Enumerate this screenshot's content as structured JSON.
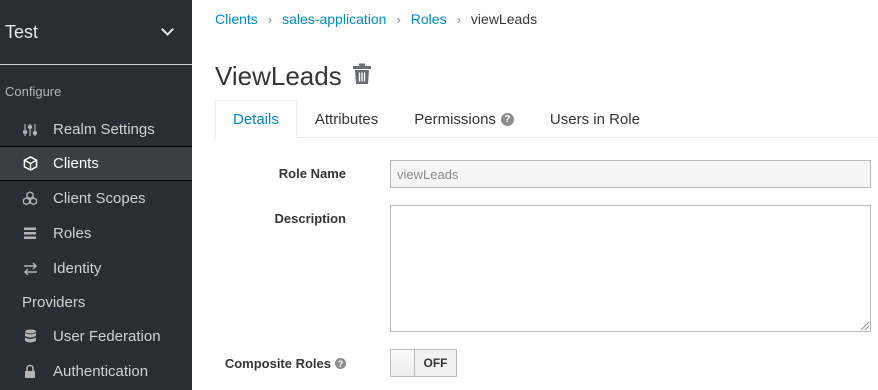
{
  "sidebar": {
    "realm": "Test",
    "section_title": "Configure",
    "items": [
      {
        "label": "Realm Settings",
        "icon": "sliders-icon"
      },
      {
        "label": "Clients",
        "icon": "cube-icon",
        "active": true
      },
      {
        "label": "Client Scopes",
        "icon": "cubes-icon"
      },
      {
        "label": "Roles",
        "icon": "list-icon"
      },
      {
        "label": "Identity",
        "icon": "exchange-icon"
      },
      {
        "label": "Providers",
        "icon": ""
      },
      {
        "label": "User Federation",
        "icon": "database-icon"
      },
      {
        "label": "Authentication",
        "icon": "lock-icon"
      }
    ]
  },
  "breadcrumb": {
    "items": [
      "Clients",
      "sales-application",
      "Roles"
    ],
    "current": "viewLeads"
  },
  "page": {
    "title": "ViewLeads"
  },
  "tabs": [
    {
      "label": "Details",
      "active": true
    },
    {
      "label": "Attributes"
    },
    {
      "label": "Permissions",
      "help": "?"
    },
    {
      "label": "Users in Role"
    }
  ],
  "form": {
    "role_name_label": "Role Name",
    "role_name_value": "viewLeads",
    "description_label": "Description",
    "description_value": "",
    "composite_label": "Composite Roles",
    "composite_help": "?",
    "composite_state": "OFF"
  },
  "colors": {
    "sidebar_bg": "#292e34",
    "link": "#0088ce"
  }
}
